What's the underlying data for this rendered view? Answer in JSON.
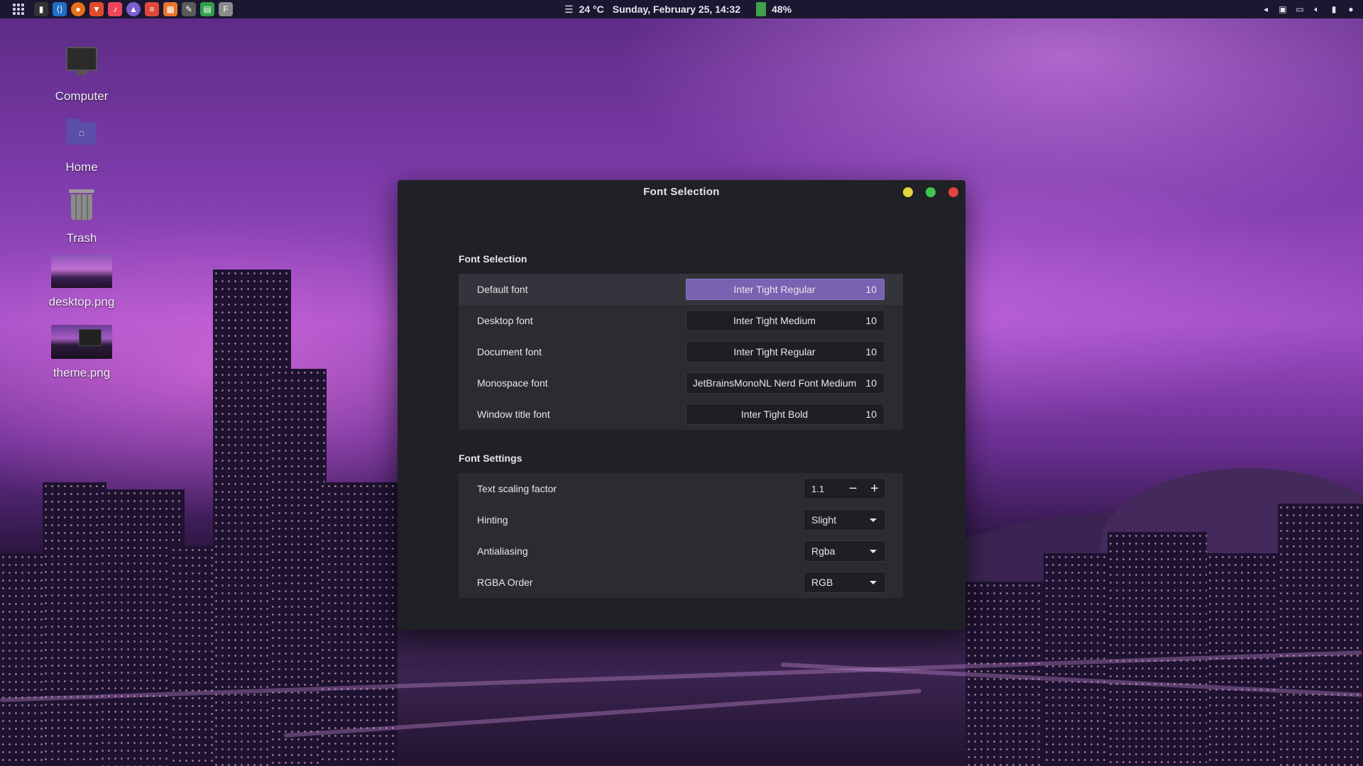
{
  "topbar": {
    "weather": "24 °C",
    "datetime": "Sunday, February 25, 14:32",
    "battery": "48%",
    "apps": [
      "terminal-icon",
      "vscode-icon",
      "firefox-icon",
      "brave-icon",
      "music-icon",
      "bug-icon",
      "todoist-icon",
      "calendar-icon",
      "notes-icon",
      "spreadsheet-icon",
      "fonts-icon"
    ]
  },
  "desktop": {
    "icons": [
      {
        "label": "Computer"
      },
      {
        "label": "Home"
      },
      {
        "label": "Trash"
      },
      {
        "label": "desktop.png"
      },
      {
        "label": "theme.png"
      }
    ]
  },
  "dialog": {
    "title": "Font Selection",
    "font_section_title": "Font Selection",
    "fonts": [
      {
        "label": "Default font",
        "font": "Inter Tight Regular",
        "size": "10"
      },
      {
        "label": "Desktop font",
        "font": "Inter Tight Medium",
        "size": "10"
      },
      {
        "label": "Document font",
        "font": "Inter Tight Regular",
        "size": "10"
      },
      {
        "label": "Monospace font",
        "font": "JetBrainsMonoNL Nerd Font Medium",
        "size": "10"
      },
      {
        "label": "Window title font",
        "font": "Inter Tight Bold",
        "size": "10"
      }
    ],
    "settings_section_title": "Font Settings",
    "settings": {
      "scaling": {
        "label": "Text scaling factor",
        "value": "1.1",
        "minus": "−",
        "plus": "+"
      },
      "hinting": {
        "label": "Hinting",
        "value": "Slight"
      },
      "antialiasing": {
        "label": "Antialiasing",
        "value": "Rgba"
      },
      "rgba_order": {
        "label": "RGBA Order",
        "value": "RGB"
      }
    }
  },
  "colors": {
    "accent": "#7a62b2",
    "close": "#e2443f",
    "minimize": "#e6d33c",
    "maximize": "#3fc64e"
  }
}
